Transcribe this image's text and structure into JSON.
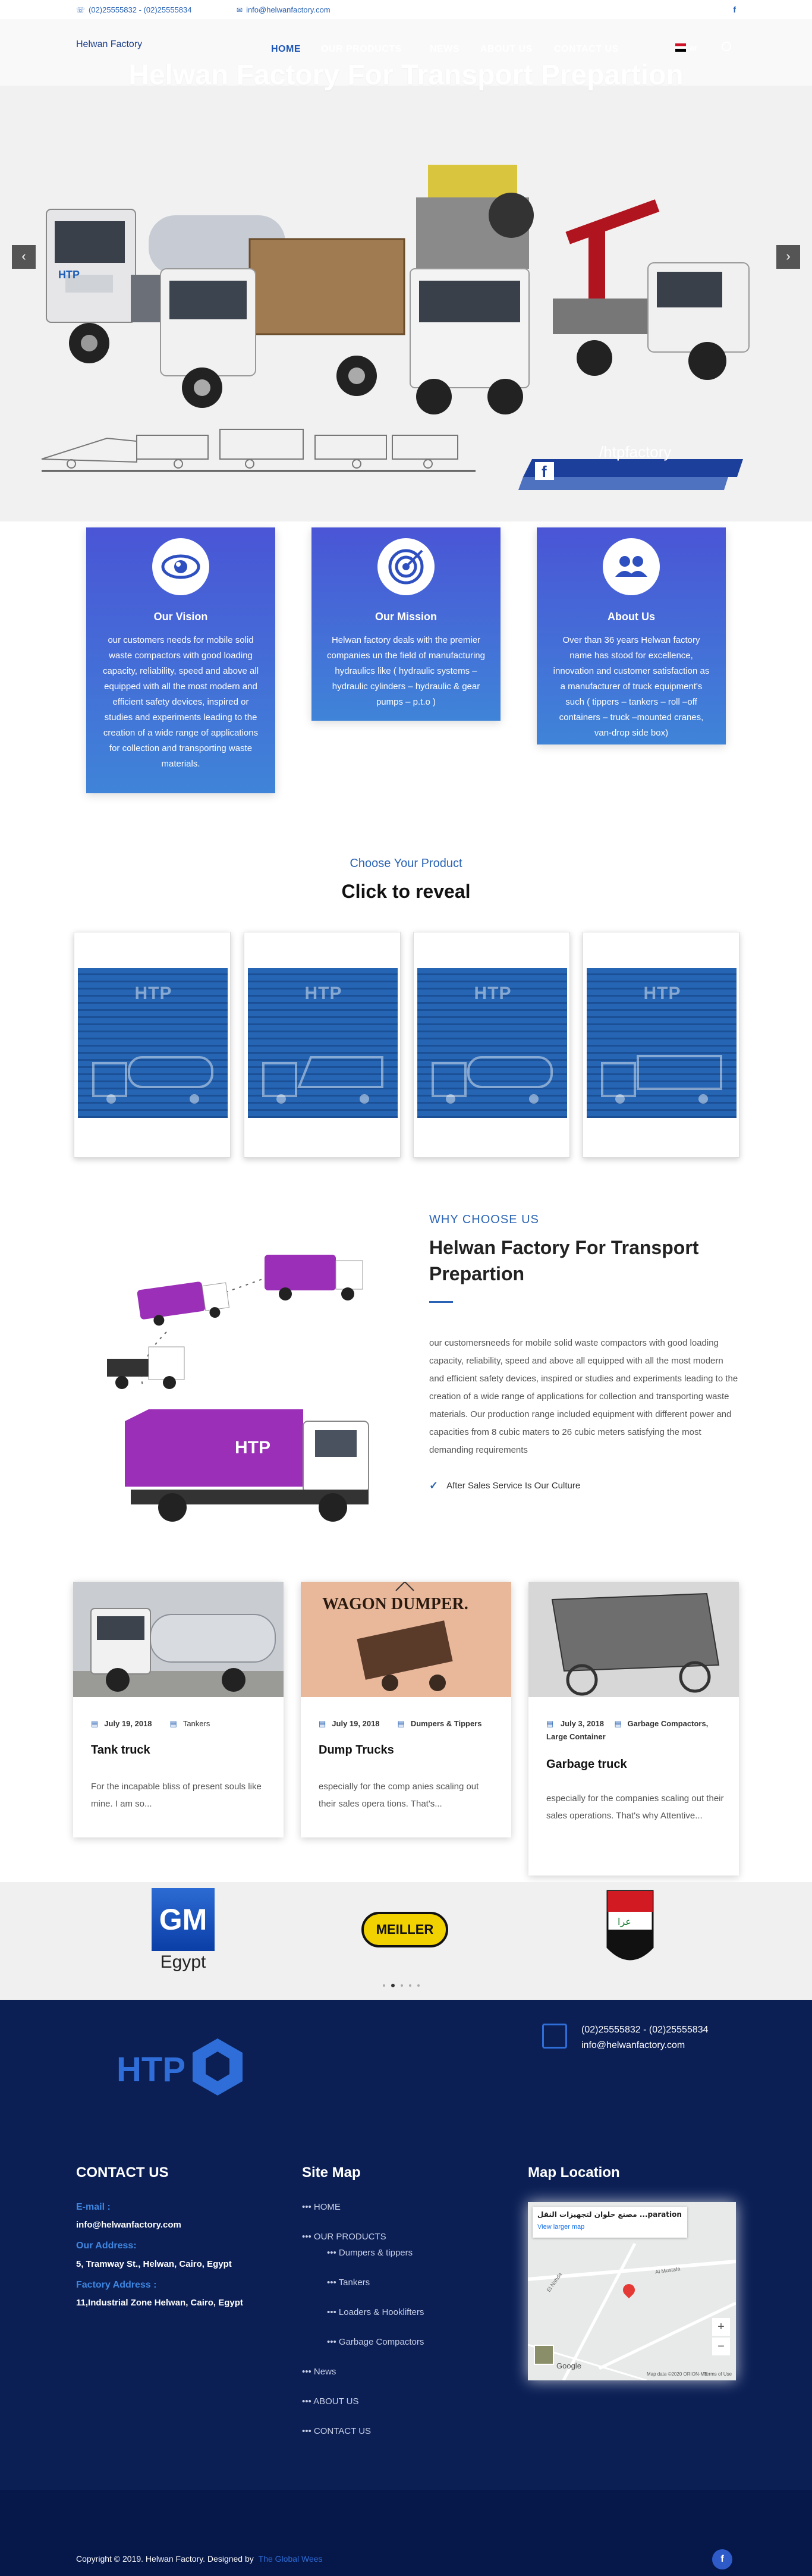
{
  "topbar": {
    "phone": "(02)25555832 - (02)25555834",
    "email": "info@helwanfactory.com",
    "social_icon": "facebook-icon"
  },
  "header": {
    "brand": "Helwan Factory",
    "nav": [
      "HOME",
      "OUR PRODUCTS",
      "NEWS",
      "ABOUT US",
      "CONTACT US"
    ],
    "active_nav": "HOME",
    "language": "ar"
  },
  "hero": {
    "title": "Helwan Factory For Transport Prepartion",
    "social_banner": "/htpfactory",
    "truck_logo": "HTP"
  },
  "features": [
    {
      "icon": "eye-icon",
      "title": "Our Vision",
      "text": "our customers needs for mobile solid waste compactors with good loading capacity, reliability, speed and above all equipped with all the most modern and efficient safety devices, inspired or studies and experiments leading to the creation of a wide range of applications for collection and transporting waste materials."
    },
    {
      "icon": "target-icon",
      "title": "Our Mission",
      "text": "Helwan factory deals with the premier companies un the field of manufacturing hydraulics like ( hydraulic systems – hydraulic cylinders – hydraulic & gear pumps – p.t.o )"
    },
    {
      "icon": "users-icon",
      "title": "About Us",
      "text": "Over than 36 years Helwan factory name has stood for excellence, innovation and customer satisfaction as a manufacturer of truck equipment's such ( tippers – tankers – roll –off containers – truck –mounted cranes, van-drop side box)"
    }
  ],
  "products": {
    "subtitle": "Choose Your Product",
    "title": "Click to reveal",
    "cards": [
      {
        "logo": "HTP",
        "icon": "tanker-truck-icon"
      },
      {
        "logo": "HTP",
        "icon": "dump-truck-icon"
      },
      {
        "logo": "HTP",
        "icon": "tanker-truck-icon"
      },
      {
        "logo": "HTP",
        "icon": "garbage-truck-icon"
      }
    ]
  },
  "why": {
    "subtitle": "WHY CHOOSE US",
    "title": "Helwan Factory For Transport Prepartion",
    "text": "our customersneeds for mobile solid waste compactors with good loading capacity, reliability, speed and above all equipped with all the most modern and efficient safety devices, inspired or studies and experiments leading to the creation of a wide range of applications for collection and transporting waste materials. Our production range included equipment with different power and capacities from 8 cubic maters to 26 cubic meters satisfying the most demanding requirements",
    "check_item": "After Sales Service Is Our Culture",
    "truck_logo": "HTP"
  },
  "news": [
    {
      "date": "July 19, 2018",
      "category": "Tankers",
      "title": "Tank truck",
      "text": "For the incapable bliss of present souls like mine. I am so..."
    },
    {
      "date": "July 19, 2018",
      "category": "Dumpers & Tippers",
      "title": "Dump Trucks",
      "text": "especially for the comp anies scaling out their sales opera tions. That's..."
    },
    {
      "date": "July 3, 2018",
      "category": "Garbage Compactors, Large Container",
      "title": "Garbage truck",
      "text": "especially for the companies scaling out their sales operations. That's why Attentive..."
    }
  ],
  "news_images": {
    "poster_title": "WAGON DUMPER."
  },
  "partners": [
    {
      "name": "GM",
      "caption": "Egypt"
    },
    {
      "name": "MEILLER"
    },
    {
      "name": "iraq-flag-logo"
    }
  ],
  "footer": {
    "logo": "HTP",
    "phone": "(02)25555832 - (02)25555834",
    "email": "info@helwanfactory.com",
    "contact_title": "CONTACT US",
    "email_label": "E-mail :",
    "email_value": "info@helwanfactory.com",
    "address_label": "Our Address:",
    "address_value": "5, Tramway St., Helwan, Cairo, Egypt",
    "factory_label": "Factory Address :",
    "factory_value": "11,Industrial Zone Helwan, Cairo, Egypt",
    "sitemap_title": "Site Map",
    "sitemap": [
      "HOME",
      "OUR PRODUCTS",
      "Dumpers & tippers",
      "Tankers",
      "Loaders & Hooklifters",
      "Garbage Compactors",
      "News",
      "ABOUT US",
      "CONTACT US"
    ],
    "map_title": "Map Location",
    "map_place": "مصنع حلوان لتجهيزات النقل ...paration",
    "map_link": "View larger map",
    "map_road_1": "El Nahda",
    "map_road_2": "Al Mustafa",
    "map_credit": "Map data ©2020 ORION-ME",
    "map_terms": "Terms of Use",
    "map_brand": "Google"
  },
  "bottom": {
    "copyright": "Copyright © 2019. Helwan Factory. Designed by",
    "designer": "The Global Wees"
  },
  "colors": {
    "accent": "#2a63b5",
    "footer_bg": "#0b1f55",
    "card_top": "#4a55d6",
    "card_bottom": "#3f84d8",
    "truck_purple": "#9b2fb7"
  }
}
